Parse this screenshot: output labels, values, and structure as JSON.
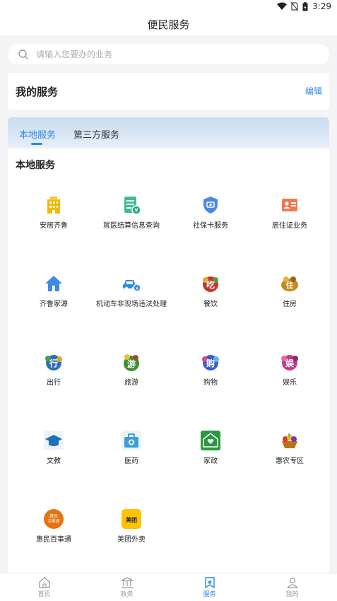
{
  "status": {
    "time": "3:29"
  },
  "header": {
    "title": "便民服务"
  },
  "search": {
    "placeholder": "请输入您要办的业务"
  },
  "my_services": {
    "title": "我的服务",
    "edit_label": "编辑"
  },
  "tabs": [
    {
      "label": "本地服务",
      "active": true
    },
    {
      "label": "第三方服务",
      "active": false
    }
  ],
  "local_services": {
    "title": "本地服务",
    "items": [
      {
        "label": "安居齐鲁",
        "icon": "building-icon"
      },
      {
        "label": "就医结算信息查询",
        "icon": "medical-bill-icon"
      },
      {
        "label": "社保卡服务",
        "icon": "shield-card-icon"
      },
      {
        "label": "居住证业务",
        "icon": "id-card-icon"
      },
      {
        "label": "齐鲁家源",
        "icon": "house-icon"
      },
      {
        "label": "机动车非现场违法处理",
        "icon": "car-icon"
      },
      {
        "label": "餐饮",
        "icon": "food-icon"
      },
      {
        "label": "住房",
        "icon": "housing-icon"
      },
      {
        "label": "出行",
        "icon": "travel-icon"
      },
      {
        "label": "旅游",
        "icon": "tourism-icon"
      },
      {
        "label": "购物",
        "icon": "shopping-icon"
      },
      {
        "label": "娱乐",
        "icon": "entertainment-icon"
      },
      {
        "label": "文教",
        "icon": "graduation-cap-icon"
      },
      {
        "label": "医药",
        "icon": "medicine-kit-icon"
      },
      {
        "label": "家政",
        "icon": "housekeeping-icon"
      },
      {
        "label": "惠农专区",
        "icon": "fruit-basket-icon"
      },
      {
        "label": "惠民百事通",
        "icon": "huimin-icon",
        "icon_text": "惠民 百事通"
      },
      {
        "label": "美团外卖",
        "icon": "meituan-icon",
        "icon_text": "美团"
      }
    ]
  },
  "bottom_nav": [
    {
      "label": "首页",
      "icon": "home-icon",
      "active": false
    },
    {
      "label": "政务",
      "icon": "government-icon",
      "active": false
    },
    {
      "label": "服务",
      "icon": "service-bookmark-icon",
      "active": true
    },
    {
      "label": "我的",
      "icon": "profile-icon",
      "active": false
    }
  ],
  "colors": {
    "accent": "#2b8ae0",
    "background": "#f4f4f6"
  }
}
